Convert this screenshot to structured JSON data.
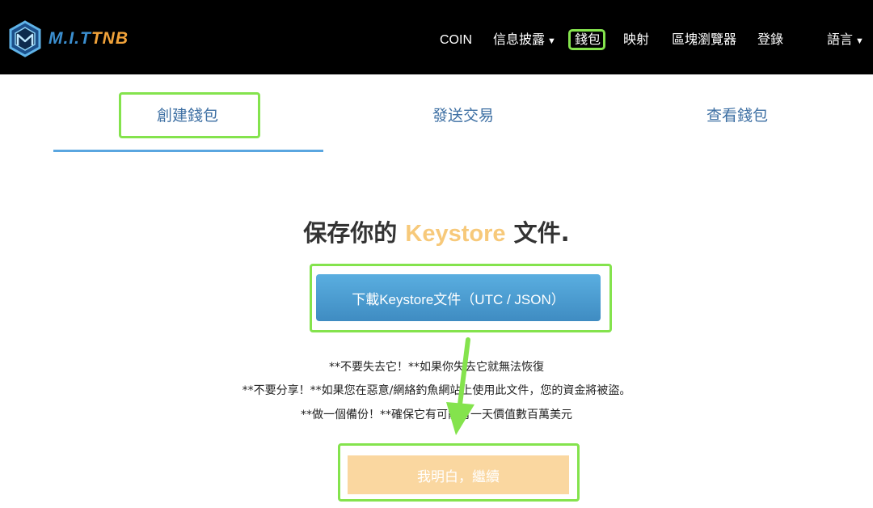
{
  "header": {
    "logo_text_part1": "M.I.T",
    "logo_text_part2": "TNB",
    "nav": {
      "coin": "COIN",
      "disclosure": "信息披露",
      "wallet": "錢包",
      "mapping": "映射",
      "explorer": "區塊瀏覽器",
      "login": "登錄",
      "language": "語言"
    }
  },
  "tabs": {
    "create": "創建錢包",
    "send": "發送交易",
    "view": "查看錢包"
  },
  "main": {
    "heading_before": "保存你的",
    "heading_accent": "Keystore",
    "heading_after": "文件.",
    "download_label": "下載Keystore文件（UTC / JSON）",
    "warning_1": "**不要失去它！**如果你失去它就無法恢復",
    "warning_2": "**不要分享！**如果您在惡意/網絡釣魚網站上使用此文件，您的資金將被盜。",
    "warning_3": "**做一個備份！**確保它有可能有一天價值數百萬美元",
    "continue_label": "我明白，繼續"
  },
  "colors": {
    "highlight": "#84e34d",
    "tab_text": "#3d6fa3",
    "accent": "#f7c97a",
    "download_bg": "#4a9dd3",
    "continue_bg": "#fad7a0"
  }
}
